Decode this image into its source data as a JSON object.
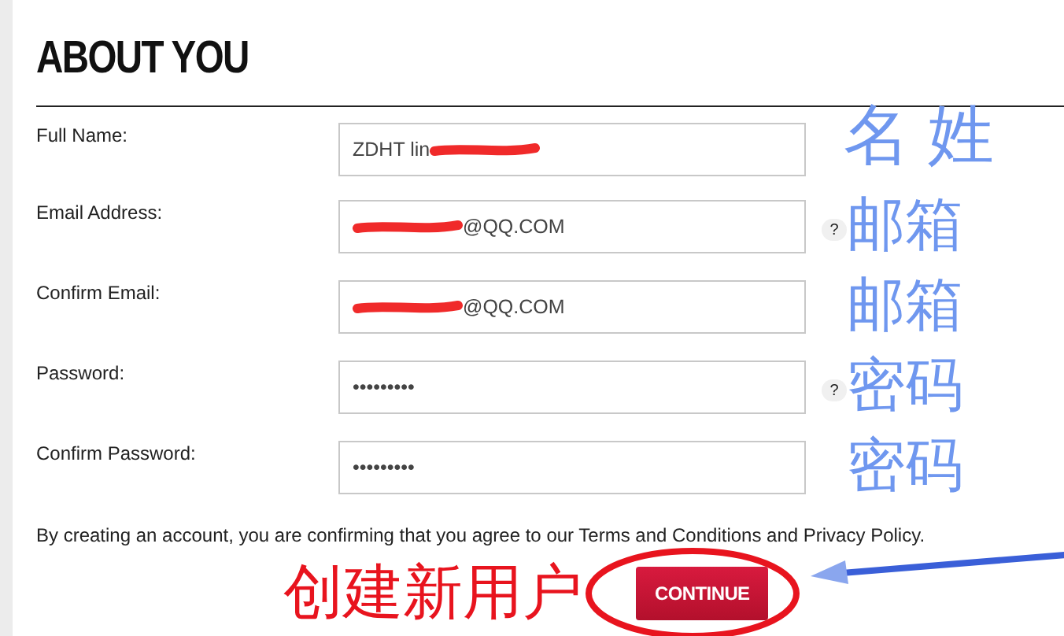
{
  "heading": "ABOUT YOU",
  "fields": [
    {
      "label": "Full Name:",
      "value": "ZDHT lin",
      "scribble_before": false,
      "scribble_after": true,
      "note": "名 姓"
    },
    {
      "label": "Email Address:",
      "value": "@QQ.COM",
      "scribble_before": true,
      "scribble_after": false,
      "help": "?",
      "note": "邮箱"
    },
    {
      "label": "Confirm Email:",
      "value": "@QQ.COM",
      "scribble_before": true,
      "scribble_after": false,
      "note": "邮箱"
    },
    {
      "label": "Password:",
      "value": "•••••••••",
      "scribble_before": false,
      "scribble_after": false,
      "help": "?",
      "note": "密码"
    },
    {
      "label": "Confirm Password:",
      "value": "•••••••••",
      "scribble_before": false,
      "scribble_after": false,
      "note": "密码"
    }
  ],
  "terms": "By creating an account, you are confirming that you agree to our Terms and Conditions and Privacy Policy.",
  "submit": {
    "label": "CONTINUE",
    "note": "创建新用户"
  }
}
